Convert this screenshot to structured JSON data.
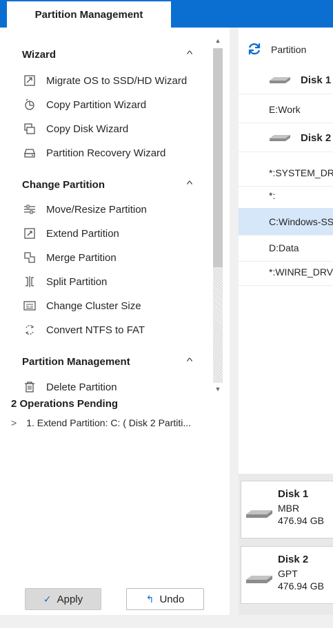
{
  "tabs": {
    "active": "Partition Management"
  },
  "sidebar": {
    "sections": [
      {
        "title": "Wizard",
        "items": [
          {
            "label": "Migrate OS to SSD/HD Wizard",
            "icon": "migrate-icon"
          },
          {
            "label": "Copy Partition Wizard",
            "icon": "copy-partition-icon"
          },
          {
            "label": "Copy Disk Wizard",
            "icon": "copy-disk-icon"
          },
          {
            "label": "Partition Recovery Wizard",
            "icon": "partition-recovery-icon"
          }
        ]
      },
      {
        "title": "Change Partition",
        "items": [
          {
            "label": "Move/Resize Partition",
            "icon": "move-resize-icon"
          },
          {
            "label": "Extend Partition",
            "icon": "extend-icon"
          },
          {
            "label": "Merge Partition",
            "icon": "merge-icon"
          },
          {
            "label": "Split Partition",
            "icon": "split-icon"
          },
          {
            "label": "Change Cluster Size",
            "icon": "cluster-size-icon"
          },
          {
            "label": "Convert NTFS to FAT",
            "icon": "convert-icon"
          }
        ]
      },
      {
        "title": "Partition Management",
        "items": [
          {
            "label": "Delete Partition",
            "icon": "trash-icon"
          }
        ]
      }
    ]
  },
  "pending": {
    "title": "2 Operations Pending",
    "items": [
      "1. Extend Partition: C: ( Disk 2 Partiti..."
    ]
  },
  "buttons": {
    "apply": "Apply",
    "undo": "Undo"
  },
  "partition_list": {
    "column_header": "Partition",
    "rows": [
      {
        "label": "Disk 1",
        "kind": "disk"
      },
      {
        "label": "E:Work",
        "kind": "partition"
      },
      {
        "label": "Disk 2",
        "kind": "disk"
      },
      {
        "label": "*:SYSTEM_DRV",
        "kind": "partition"
      },
      {
        "label": "*:",
        "kind": "partition"
      },
      {
        "label": "C:Windows-SSD",
        "kind": "partition",
        "selected": true
      },
      {
        "label": "D:Data",
        "kind": "partition"
      },
      {
        "label": "*:WINRE_DRV",
        "kind": "partition"
      }
    ]
  },
  "disk_map": [
    {
      "name": "Disk 1",
      "type": "MBR",
      "size": "476.94 GB"
    },
    {
      "name": "Disk 2",
      "type": "GPT",
      "size": "476.94 GB"
    }
  ],
  "colors": {
    "accent": "#0b6fd1",
    "selected_row": "#d5e7f8"
  }
}
